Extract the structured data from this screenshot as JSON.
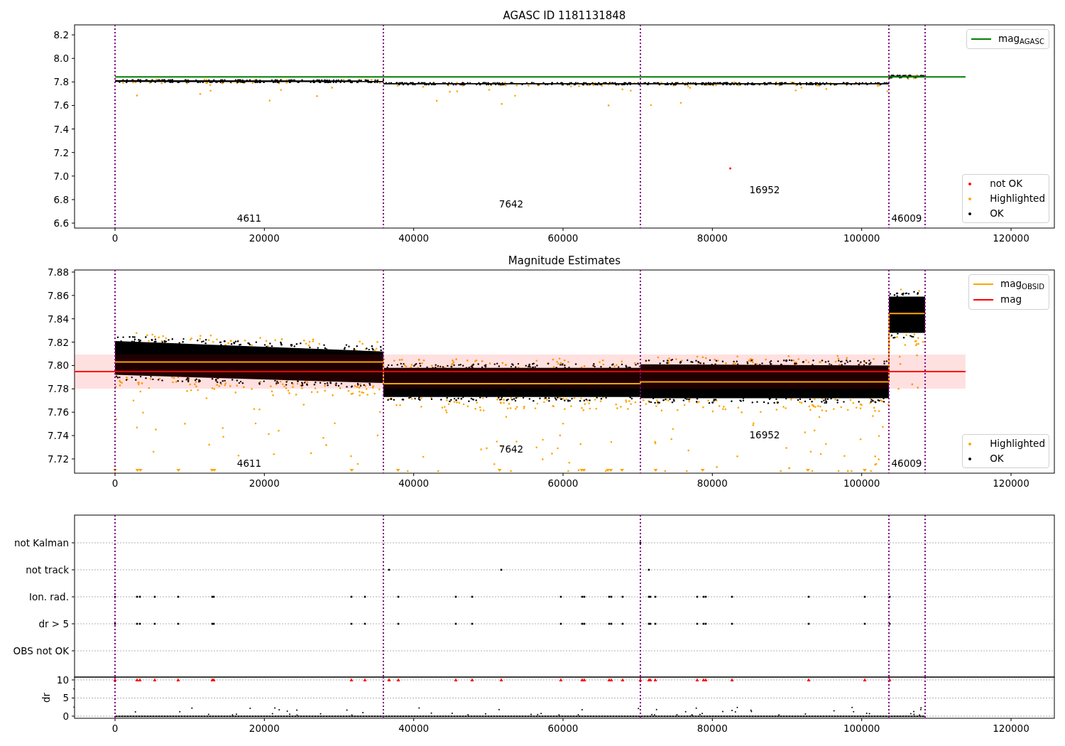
{
  "panels": [
    {
      "chart_data": {
        "type": "line",
        "title": "AGASC ID 1181131848",
        "series": [
          {
            "name": "mag$_{AGASC}$",
            "color": "#008000",
            "x": [
              0,
              113900
            ],
            "values": [
              7.843,
              7.843
            ]
          }
        ],
        "xlim": [
          -5420,
          125800
        ],
        "ylim": [
          6.558,
          8.285
        ],
        "xticks": [
          {
            "value": 0,
            "label": "0"
          },
          {
            "value": 20000,
            "label": "20000"
          },
          {
            "value": 40000,
            "label": "40000"
          },
          {
            "value": 60000,
            "label": "60000"
          },
          {
            "value": 80000,
            "label": "80000"
          },
          {
            "value": 100000,
            "label": "100000"
          },
          {
            "value": 120000,
            "label": "120000"
          }
        ],
        "yticks": [
          {
            "value": 6.6,
            "label": "6.6"
          },
          {
            "value": 6.8,
            "label": "6.8"
          },
          {
            "value": 7.0,
            "label": "7.0"
          },
          {
            "value": 7.2,
            "label": "7.2"
          },
          {
            "value": 7.4,
            "label": "7.4"
          },
          {
            "value": 7.6,
            "label": "7.6"
          },
          {
            "value": 7.8,
            "label": "7.8"
          },
          {
            "value": 8.0,
            "label": "8.0"
          },
          {
            "value": 8.2,
            "label": "8.2"
          }
        ],
        "ref_lines": [
          {
            "axis": "x",
            "value": 0
          },
          {
            "axis": "x",
            "value": 35940
          },
          {
            "axis": "x",
            "value": 70360
          },
          {
            "axis": "x",
            "value": 103640
          },
          {
            "axis": "x",
            "value": 108490
          }
        ],
        "annotations": [
          "4611",
          "7642",
          "16952",
          "46009"
        ]
      },
      "point_legend": [
        {
          "label": "not OK",
          "color": "#ff0000"
        },
        {
          "label": "Highlighted",
          "color": "#ffa500"
        },
        {
          "label": "OK",
          "color": "#000000"
        }
      ]
    },
    {
      "chart_data": {
        "type": "line",
        "title": "Magnitude Estimates",
        "series": [
          {
            "name": "mag$_{OBSID}$",
            "color": "#ffa500",
            "x": [
              0,
              35940,
              35940,
              70360,
              70360,
              103640,
              103640,
              108490
            ],
            "values": [
              7.803,
              7.803,
              7.7845,
              7.7845,
              7.786,
              7.786,
              7.8445,
              7.8445
            ]
          },
          {
            "name": "mag",
            "color": "#ff0000",
            "x": [
              -5420,
              113900
            ],
            "values": [
              7.7948,
              7.7948
            ]
          }
        ],
        "xlim": [
          -5420,
          125800
        ],
        "ylim": [
          7.7078,
          7.8818
        ],
        "xticks": [
          {
            "value": 0,
            "label": "0"
          },
          {
            "value": 20000,
            "label": "20000"
          },
          {
            "value": 40000,
            "label": "40000"
          },
          {
            "value": 60000,
            "label": "60000"
          },
          {
            "value": 80000,
            "label": "80000"
          },
          {
            "value": 100000,
            "label": "100000"
          },
          {
            "value": 120000,
            "label": "120000"
          }
        ],
        "yticks": [
          {
            "value": 7.72,
            "label": "7.72"
          },
          {
            "value": 7.74,
            "label": "7.74"
          },
          {
            "value": 7.76,
            "label": "7.76"
          },
          {
            "value": 7.78,
            "label": "7.78"
          },
          {
            "value": 7.8,
            "label": "7.80"
          },
          {
            "value": 7.82,
            "label": "7.82"
          },
          {
            "value": 7.84,
            "label": "7.84"
          },
          {
            "value": 7.86,
            "label": "7.86"
          },
          {
            "value": 7.88,
            "label": "7.88"
          }
        ],
        "bands": [
          {
            "axis": "y",
            "from": 7.7802,
            "to": 7.8094
          }
        ],
        "ref_lines": [
          {
            "axis": "x",
            "value": 0
          },
          {
            "axis": "x",
            "value": 35940
          },
          {
            "axis": "x",
            "value": 70360
          },
          {
            "axis": "x",
            "value": 103640
          },
          {
            "axis": "x",
            "value": 108490
          }
        ],
        "annotations": [
          "4611",
          "7642",
          "16952",
          "46009"
        ]
      },
      "point_legend": [
        {
          "label": "Highlighted",
          "color": "#ffa500"
        },
        {
          "label": "OK",
          "color": "#000000"
        }
      ]
    },
    {
      "flag_labels": [
        "not Kalman",
        "not track",
        "Ion. rad.",
        "dr > 5",
        "OBS not OK"
      ]
    },
    {
      "chart_data": {
        "type": "scatter",
        "ylabel": "dr",
        "x": [
          0,
          2950,
          3330,
          5320,
          8460,
          13030,
          13220,
          31660,
          33470,
          36700,
          37940,
          45640,
          47830,
          51730,
          59710,
          62570,
          62850,
          66180,
          66460,
          67980,
          70360,
          71500,
          71690,
          72360,
          77970,
          78820,
          79110,
          82630,
          92900,
          100410,
          103740
        ],
        "grid": true,
        "series": [
          {
            "color": "#ff0000",
            "values": [
              10,
              10,
              10,
              10,
              10,
              10,
              10,
              10,
              10,
              10,
              10,
              10,
              10,
              10,
              10,
              10,
              10,
              10,
              10,
              10,
              10,
              10,
              10,
              10,
              10,
              10,
              10,
              10,
              10,
              10,
              10
            ]
          }
        ],
        "xlim": [
          -5420,
          125800
        ],
        "ylim": [
          -0.59,
          10.78
        ],
        "xticks": [
          {
            "value": 0,
            "label": "0"
          },
          {
            "value": 20000,
            "label": "20000"
          },
          {
            "value": 40000,
            "label": "40000"
          },
          {
            "value": 60000,
            "label": "60000"
          },
          {
            "value": 80000,
            "label": "80000"
          },
          {
            "value": 100000,
            "label": "100000"
          },
          {
            "value": 120000,
            "label": "120000"
          }
        ],
        "yticks": [
          {
            "value": 0,
            "label": "0"
          },
          {
            "value": 5,
            "label": "5"
          },
          {
            "value": 10,
            "label": "10"
          }
        ],
        "ref_lines": [
          {
            "axis": "x",
            "value": 0
          },
          {
            "axis": "x",
            "value": 35940
          },
          {
            "axis": "x",
            "value": 70360
          },
          {
            "axis": "x",
            "value": 103640
          },
          {
            "axis": "x",
            "value": 108490
          }
        ]
      }
    }
  ]
}
